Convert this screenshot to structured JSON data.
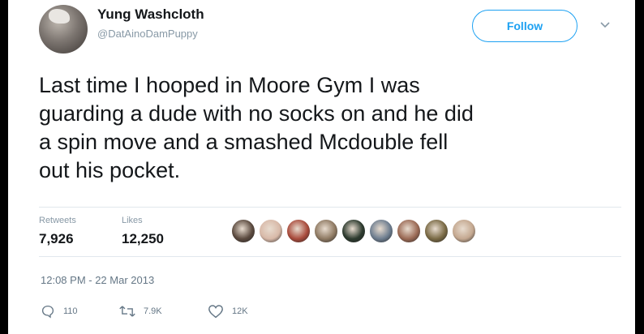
{
  "user": {
    "display_name": "Yung Washcloth",
    "handle": "@DatAinoDamPuppy"
  },
  "follow_label": "Follow",
  "tweet": {
    "text": "Last time I hooped in Moore Gym I was\nguarding a dude with no socks on and he did\na spin move and a smashed Mcdouble fell\nout his pocket."
  },
  "stats": {
    "retweets_label": "Retweets",
    "retweets_value": "7,926",
    "likes_label": "Likes",
    "likes_value": "12,250"
  },
  "likers": [
    {
      "color": "#5b4a3f"
    },
    {
      "color": "#d8b9a8"
    },
    {
      "color": "#a94b3c"
    },
    {
      "color": "#8f7a63"
    },
    {
      "color": "#2c3a2e"
    },
    {
      "color": "#6d7d8f"
    },
    {
      "color": "#9b6a55"
    },
    {
      "color": "#7a6a45"
    },
    {
      "color": "#c4a890"
    }
  ],
  "timestamp": "12:08 PM - 22 Mar 2013",
  "actions": {
    "reply_count": "110",
    "retweet_count": "7.9K",
    "like_count": "12K"
  },
  "colors": {
    "accent": "#1da1f2",
    "text": "#14171a",
    "muted": "#8899a6"
  }
}
